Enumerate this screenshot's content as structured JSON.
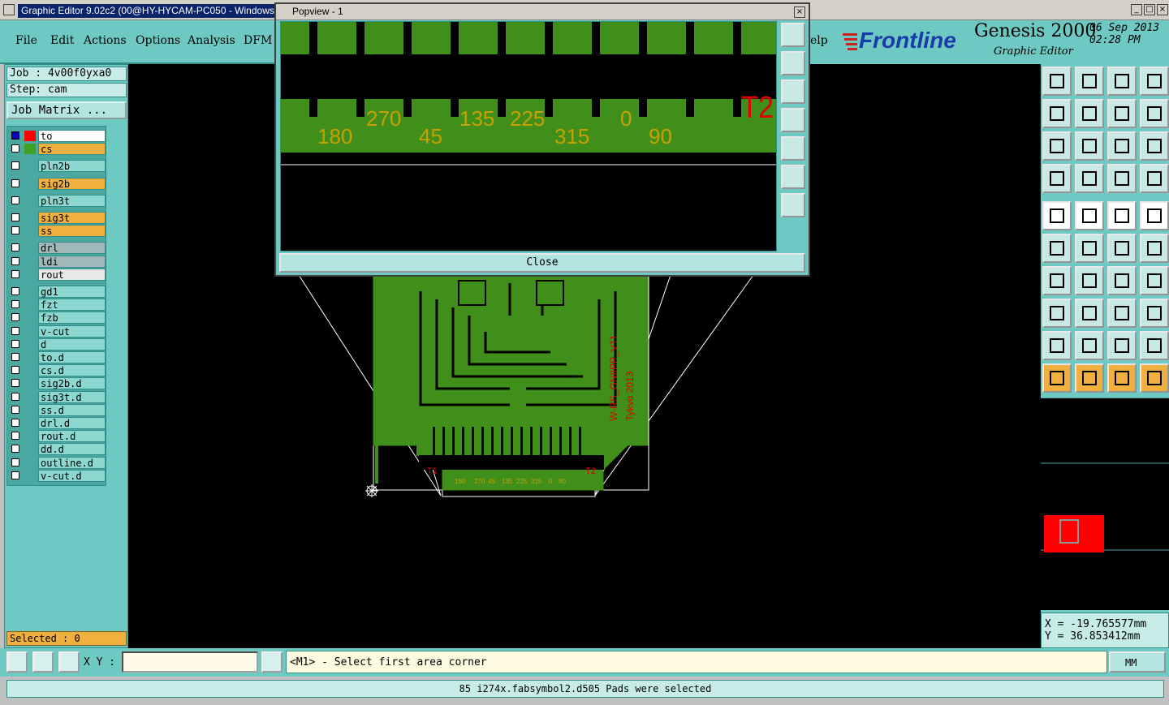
{
  "window": {
    "title": "Graphic Editor 9.02c2 (00@HY-HYCAM-PC050 - Windows",
    "minimize_glyph": "_",
    "maximize_glyph": "□",
    "close_glyph": "×"
  },
  "menu": {
    "items": [
      {
        "label": "File"
      },
      {
        "label": "Edit"
      },
      {
        "label": "Actions"
      },
      {
        "label": "Options"
      },
      {
        "label": "Analysis"
      },
      {
        "label": "DFM"
      }
    ],
    "help_partial": "elp"
  },
  "logo": {
    "brand": "Frontline",
    "product": "Genesis 2000",
    "subtitle": "Graphic Editor",
    "date": "06 Sep 2013",
    "time": "02:28 PM"
  },
  "job": {
    "job_line": "Job : 4v00f0yxa0",
    "step_line": "Step: cam",
    "job_matrix_label": "Job Matrix ..."
  },
  "layers": [
    {
      "name": "to",
      "color": "#ffffff",
      "group": 0,
      "c1": "#0000c0",
      "c2": "#ff0000"
    },
    {
      "name": "cs",
      "color": "#f0b040",
      "group": 0,
      "c1": "#ffffff",
      "c2": "#40a020"
    },
    {
      "name": "pln2b",
      "color": "#8cd8d0",
      "group": 1
    },
    {
      "name": "sig2b",
      "color": "#f0b040",
      "group": 2
    },
    {
      "name": "pln3t",
      "color": "#8cd8d0",
      "group": 3
    },
    {
      "name": "sig3t",
      "color": "#f0b040",
      "group": 4
    },
    {
      "name": "ss",
      "color": "#f0b040",
      "group": 4
    },
    {
      "name": "drl",
      "color": "#a0b8b8",
      "group": 5
    },
    {
      "name": "ldi",
      "color": "#a0b8b8",
      "group": 5
    },
    {
      "name": "rout",
      "color": "#e8e8e8",
      "group": 5
    },
    {
      "name": "gd1",
      "color": "#8cd8d0",
      "group": 6
    },
    {
      "name": "fzt",
      "color": "#8cd8d0",
      "group": 6
    },
    {
      "name": "fzb",
      "color": "#8cd8d0",
      "group": 6
    },
    {
      "name": "v-cut",
      "color": "#8cd8d0",
      "group": 6
    },
    {
      "name": "d",
      "color": "#8cd8d0",
      "group": 6
    },
    {
      "name": "to.d",
      "color": "#8cd8d0",
      "group": 6
    },
    {
      "name": "cs.d",
      "color": "#8cd8d0",
      "group": 6
    },
    {
      "name": "sig2b.d",
      "color": "#8cd8d0",
      "group": 6
    },
    {
      "name": "sig3t.d",
      "color": "#8cd8d0",
      "group": 6
    },
    {
      "name": "ss.d",
      "color": "#8cd8d0",
      "group": 6
    },
    {
      "name": "drl.d",
      "color": "#8cd8d0",
      "group": 6
    },
    {
      "name": "rout.d",
      "color": "#8cd8d0",
      "group": 6
    },
    {
      "name": "dd.d",
      "color": "#8cd8d0",
      "group": 6
    },
    {
      "name": "outline.d",
      "color": "#8cd8d0",
      "group": 6
    },
    {
      "name": "v-cut.d",
      "color": "#8cd8d0",
      "group": 6
    }
  ],
  "selected_label": "Selected : 0",
  "popview": {
    "title": "Popview - 1",
    "close_label": "Close",
    "labels": [
      "180",
      "270",
      "45",
      "135",
      "225",
      "315",
      "0",
      "90"
    ],
    "marker": "T2"
  },
  "board": {
    "text_vertical_1": "W-RS_GNIIPP_V11",
    "text_vertical_2": "Tykvo 2013",
    "t1": "T1",
    "t2": "T2",
    "small_labels": [
      "180",
      "270",
      "45",
      "135",
      "225",
      "315",
      "0",
      "90"
    ]
  },
  "coords": {
    "x": "X = -19.765577mm",
    "y": "Y = 36.853412mm"
  },
  "bottom": {
    "xy_label": "X Y :",
    "xy_value": "",
    "prompt": "<M1> - Select first area corner",
    "units": "MM",
    "status": "85 i274x.fabsymbol2.d505 Pads were selected"
  },
  "colors": {
    "panel": "#6ec9c2",
    "copper": "#3f8f1a",
    "label": "#c8a000",
    "marker": "#ff0000"
  }
}
